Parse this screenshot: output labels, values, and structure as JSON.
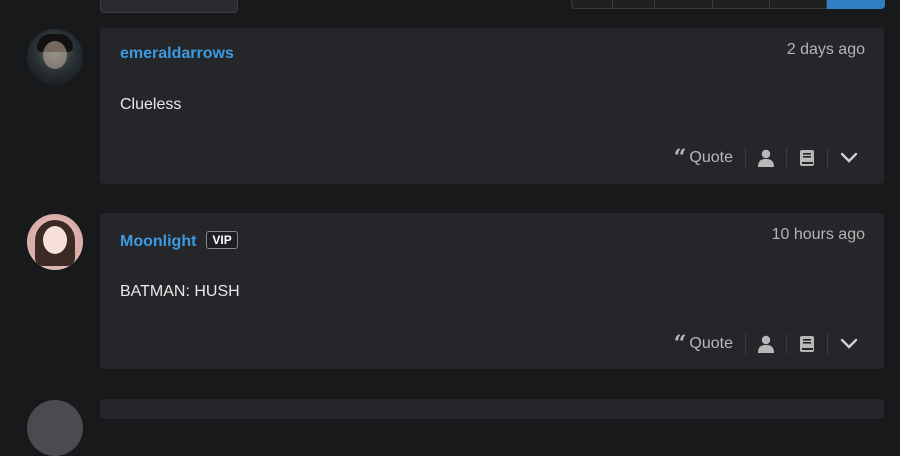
{
  "posts": [
    {
      "username": "emeraldarrows",
      "badge": "",
      "timestamp": "2 days ago",
      "content": "Clueless",
      "actions": {
        "quote_label": "Quote"
      }
    },
    {
      "username": "Moonlight",
      "badge": "VIP",
      "timestamp": "10 hours ago",
      "content": "BATMAN: HUSH",
      "actions": {
        "quote_label": "Quote"
      }
    }
  ],
  "icons": {
    "quote": "quote-icon",
    "profile": "user-icon",
    "book": "book-icon",
    "more": "chevron-down-icon"
  },
  "colors": {
    "accent": "#3c9ae0",
    "background": "#18191b",
    "card": "#25262a",
    "pagination_active": "#2f7fc4"
  }
}
